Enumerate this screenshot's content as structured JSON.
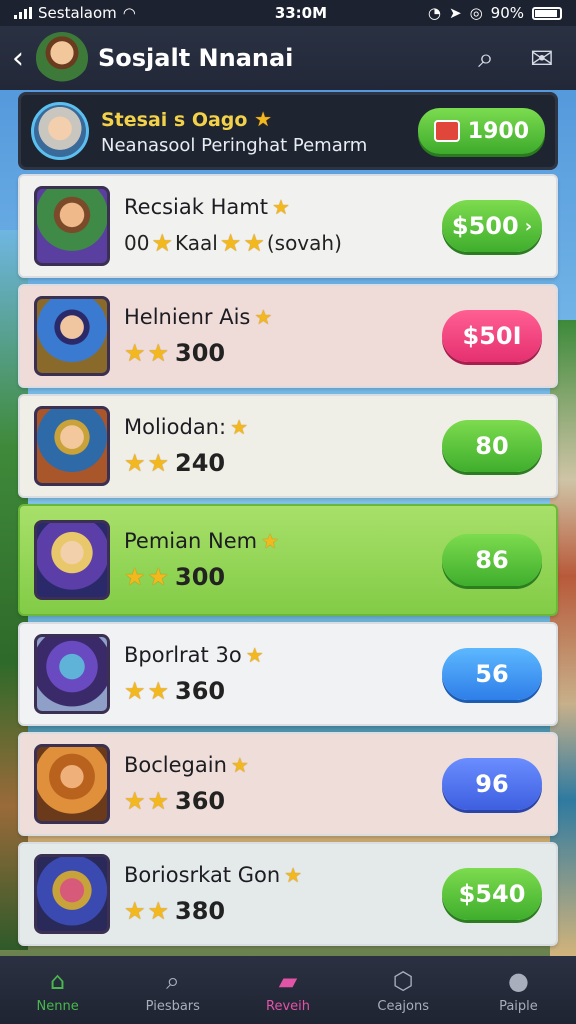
{
  "status_bar": {
    "carrier": "Sestalaom",
    "time": "33:0M",
    "battery": "90%"
  },
  "header": {
    "title": "Sosjalt Nnanai"
  },
  "hero": {
    "name": "Stesai s Oago",
    "subtitle": "Neanasool Peringhat Pemarm",
    "coins": "1900"
  },
  "items": [
    {
      "name": "Recsiak Hamt",
      "rating_text": "Kaal",
      "rating_prefix": "00",
      "rating_suffix": "(sovah)",
      "price": "$500",
      "color": "green"
    },
    {
      "name": "Helnienr Ais",
      "rating_text": "300",
      "price": "$50I",
      "color": "pink"
    },
    {
      "name": "Moliodan:",
      "rating_text": "240",
      "price": "80",
      "color": "green"
    },
    {
      "name": "Pemian Nem",
      "rating_text": "300",
      "price": "86",
      "color": "green"
    },
    {
      "name": "Bporlrat 3o",
      "rating_text": "360",
      "price": "56",
      "color": "blue"
    },
    {
      "name": "Boclegain",
      "rating_text": "360",
      "price": "96",
      "color": "indigo"
    },
    {
      "name": "Boriosrkat Gon",
      "rating_text": "380",
      "price": "$540",
      "color": "green"
    }
  ],
  "tabs": [
    {
      "label": "Nenne",
      "icon": "home-icon"
    },
    {
      "label": "Piesbars",
      "icon": "search-icon"
    },
    {
      "label": "Reveih",
      "icon": "card-icon"
    },
    {
      "label": "Ceajons",
      "icon": "badge-icon"
    },
    {
      "label": "Paiple",
      "icon": "chat-icon"
    }
  ]
}
